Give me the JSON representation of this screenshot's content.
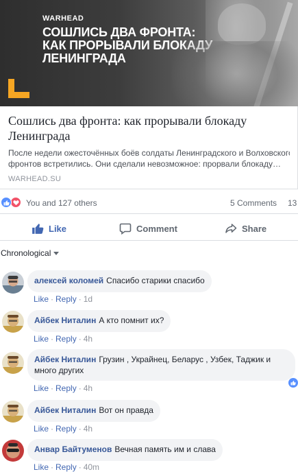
{
  "post": {
    "image": {
      "brand": "WARHEAD",
      "title_lines": [
        "СОШЛИСЬ ДВА ФРОНТА:",
        "КАК ПРОРЫВАЛИ БЛОКАДУ",
        "ЛЕНИНГРАДА"
      ],
      "logo_icon": "warhead-l-logo"
    },
    "link_title": "Сошлись два фронта: как прорывали блокаду Ленинграда",
    "link_description_line1": "После недели ожесточённых боёв солдаты Ленинградского и Волховского",
    "link_description_line2": "фронтов встретились. Они сделали невозможное: прорвали блокаду…",
    "link_domain": "WARHEAD.SU"
  },
  "reactions": {
    "icons": [
      "like-icon",
      "love-icon"
    ],
    "summary": "You and 127 others",
    "comments_count": "5 Comments",
    "shares_count": "13"
  },
  "actions": {
    "like": "Like",
    "comment": "Comment",
    "share": "Share"
  },
  "sort": {
    "selected": "Chronological"
  },
  "meta_labels": {
    "like": "Like",
    "reply": "Reply",
    "separator": "·"
  },
  "comments": [
    {
      "author": "алексей коломей",
      "text": "Спасибо старики спасибо",
      "time": "1d"
    },
    {
      "author": "Айбек Ниталин",
      "text": "А кто помнит их?",
      "time": "4h"
    },
    {
      "author": "Айбек Ниталин",
      "text_line1": "Грузин , Украйнец, Беларус , Узбек, Таджик и",
      "text_line2": "много других",
      "time": "4h",
      "has_reaction": true
    },
    {
      "author": "Айбек Ниталин",
      "text": "Вот он правда",
      "time": "4h"
    },
    {
      "author": "Анвар Байтуменов",
      "text": "Вечная память им и слава",
      "time": "40m"
    }
  ],
  "colors": {
    "link_blue": "#4267b2",
    "author_blue": "#385898",
    "bubble_bg": "#f2f3f5",
    "muted": "#90949c",
    "logo_orange": "#f6a623",
    "love_red": "#f25268",
    "like_blue": "#5890ff"
  }
}
